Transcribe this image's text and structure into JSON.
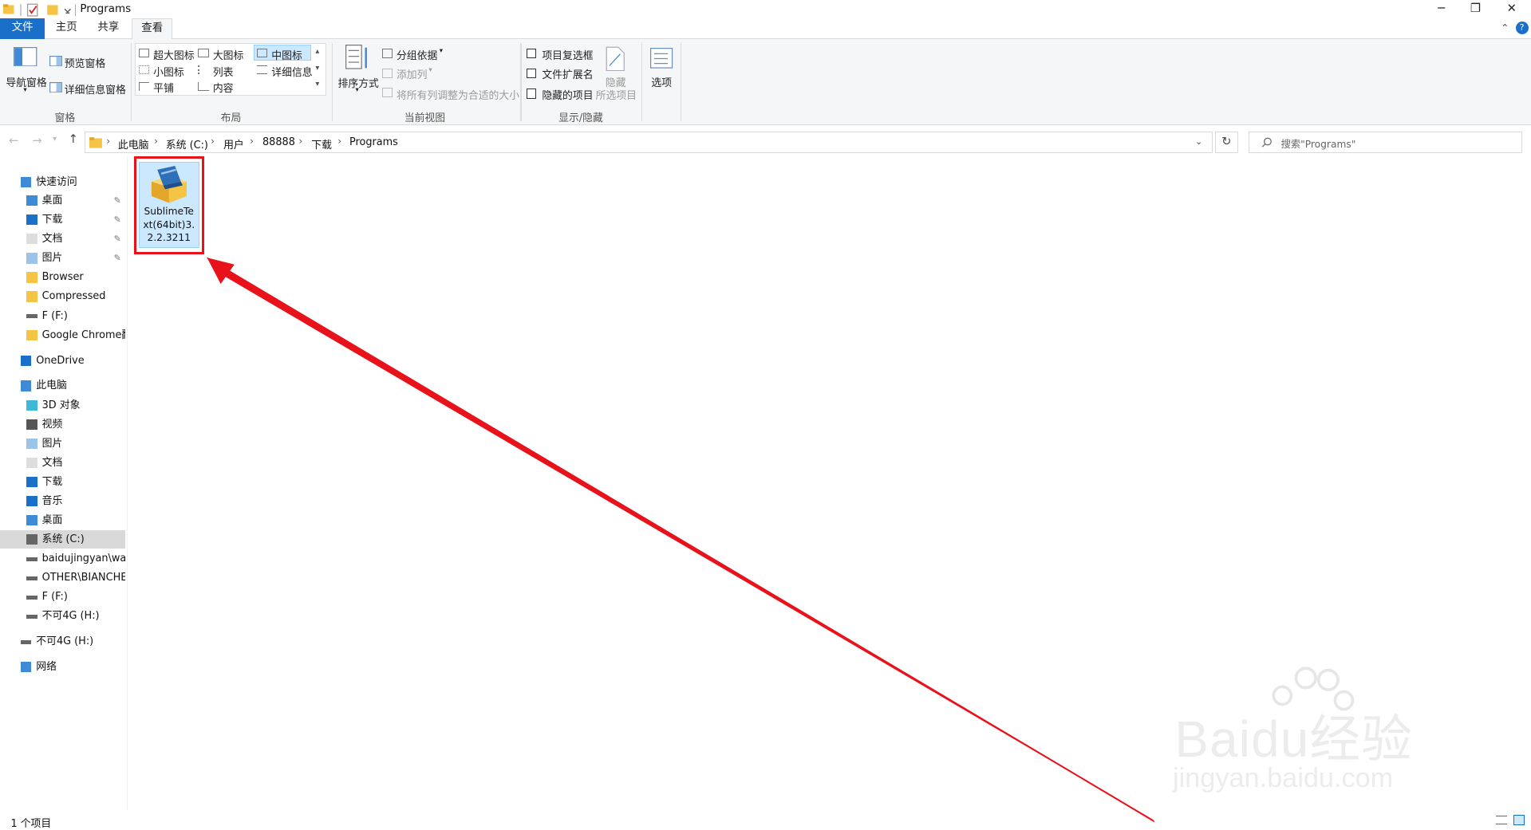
{
  "window": {
    "title": "Programs",
    "minimize_glyph": "─",
    "maximize_glyph": "❐",
    "close_glyph": "✕"
  },
  "tabs": [
    {
      "label": "文件"
    },
    {
      "label": "主页"
    },
    {
      "label": "共享"
    },
    {
      "label": "查看"
    }
  ],
  "ribbon": {
    "panes": {
      "nav_pane": "导航窗格",
      "preview_pane": "预览窗格",
      "details_pane": "详细信息窗格",
      "group_label": "窗格"
    },
    "layout": {
      "items": [
        "超大图标",
        "大图标",
        "中图标",
        "小图标",
        "列表",
        "详细信息",
        "平铺",
        "内容"
      ],
      "selected": "中图标",
      "group_label": "布局"
    },
    "current_view": {
      "sort_by": "排序方式",
      "group_by": "分组依据",
      "add_columns": "添加列",
      "size_all_columns": "将所有列调整为合适的大小",
      "group_label": "当前视图"
    },
    "show_hide": {
      "item_checkboxes": "项目复选框",
      "file_extensions": "文件扩展名",
      "hidden_items": "隐藏的项目",
      "hide_selected_1": "隐藏",
      "hide_selected_2": "所选项目",
      "group_label": "显示/隐藏"
    },
    "options": "选项",
    "help": "?"
  },
  "address": {
    "crumbs": [
      "此电脑",
      "系统 (C:)",
      "用户",
      "88888",
      "下载",
      "Programs"
    ],
    "search_placeholder": "搜索\"Programs\""
  },
  "sidebar": {
    "quick_access": "快速访问",
    "quick_items": [
      "桌面",
      "下载",
      "文档",
      "图片",
      "Browser",
      "Compressed",
      "F (F:)",
      "Google Chrome翻"
    ],
    "onedrive": "OneDrive",
    "this_pc": "此电脑",
    "pc_items": [
      "3D 对象",
      "视频",
      "图片",
      "文档",
      "下载",
      "音乐",
      "桌面",
      "系统 (C:)",
      "baidujingyan\\wan",
      "OTHER\\BIANCHEN",
      "F (F:)",
      "不可4G (H:)"
    ],
    "drive_h": "不可4G (H:)",
    "network": "网络",
    "pin_glyph": "✎"
  },
  "files": [
    {
      "name_line1": "SublimeTe",
      "name_line2": "xt(64bit)3.",
      "name_line3": "2.2.3211"
    }
  ],
  "status": {
    "count": "1 个项目"
  },
  "annotation": {
    "arrow_color": "#e8121b"
  },
  "watermark": {
    "line1": "Baidu经验",
    "line2": "jingyan.baidu.com"
  },
  "colors": {
    "file_tab": "#1a6fc9",
    "selection": "#cce8ff",
    "red": "#e8121b"
  }
}
